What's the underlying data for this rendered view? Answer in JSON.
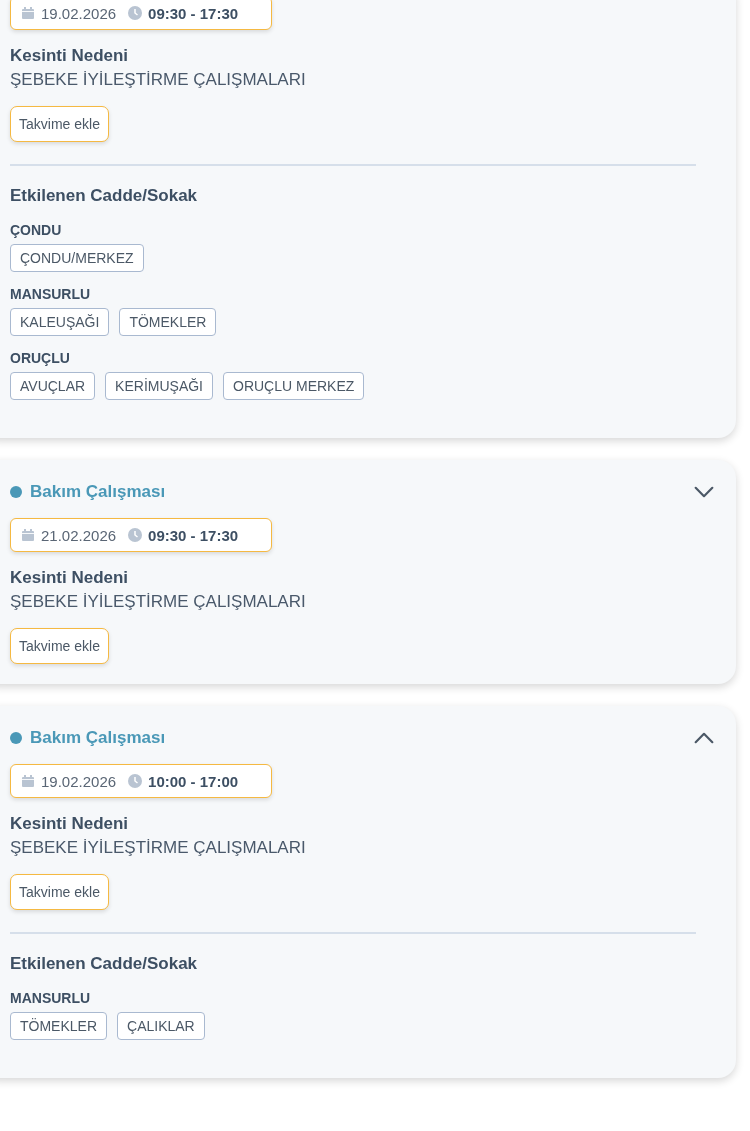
{
  "outages": [
    {
      "expanded": true,
      "date": "19.02.2026",
      "time": "09:30 - 17:30",
      "reason_label": "Kesinti Nedeni",
      "reason": "ŞEBEKE İYİLEŞTİRME ÇALIŞMALARI",
      "calendar_button": "Takvime ekle",
      "streets_title": "Etkilenen Cadde/Sokak",
      "districts": [
        {
          "name": "ÇONDU",
          "streets": [
            "ÇONDU/MERKEZ"
          ]
        },
        {
          "name": "MANSURLU",
          "streets": [
            "KALEUŞAĞI",
            "TÖMEKLER"
          ]
        },
        {
          "name": "ORUÇLU",
          "streets": [
            "AVUÇLAR",
            "KERİMUŞAĞI",
            "ORUÇLU MERKEZ"
          ]
        }
      ]
    },
    {
      "title": "Bakım Çalışması",
      "expanded": false,
      "date": "21.02.2026",
      "time": "09:30 - 17:30",
      "reason_label": "Kesinti Nedeni",
      "reason": "ŞEBEKE İYİLEŞTİRME ÇALIŞMALARI",
      "calendar_button": "Takvime ekle"
    },
    {
      "title": "Bakım Çalışması",
      "expanded": true,
      "date": "19.02.2026",
      "time": "10:00 - 17:00",
      "reason_label": "Kesinti Nedeni",
      "reason": "ŞEBEKE İYİLEŞTİRME ÇALIŞMALARI",
      "calendar_button": "Takvime ekle",
      "streets_title": "Etkilenen Cadde/Sokak",
      "districts": [
        {
          "name": "MANSURLU",
          "streets": [
            "TÖMEKLER",
            "ÇALIKLAR"
          ]
        }
      ]
    }
  ]
}
